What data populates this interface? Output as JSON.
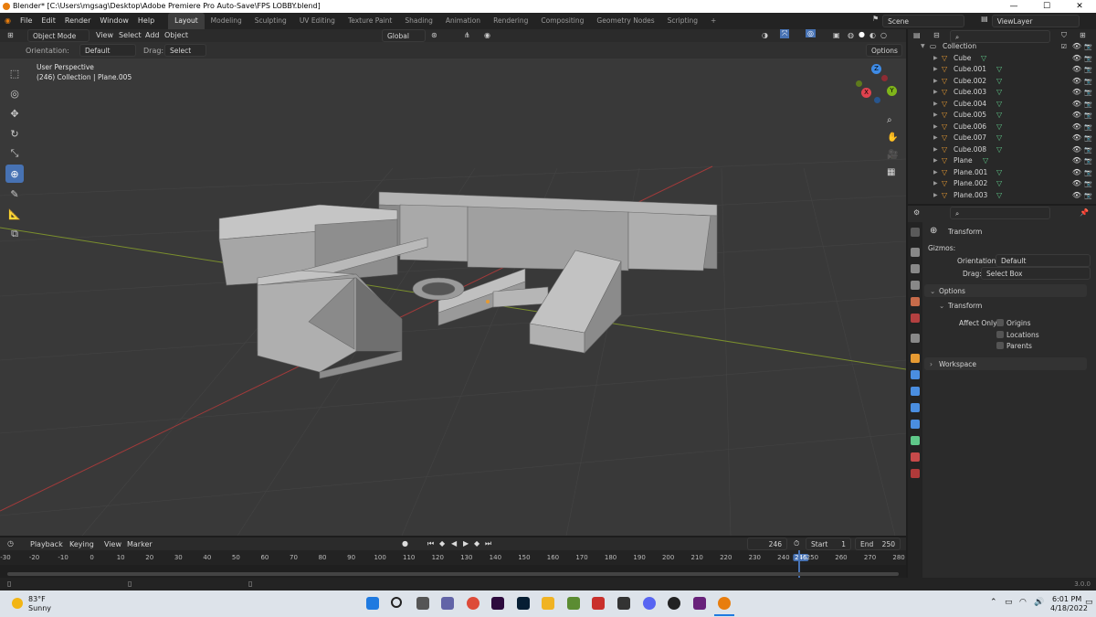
{
  "window": {
    "title": "Blender* [C:\\Users\\mgsag\\Desktop\\Adobe Premiere Pro Auto-Save\\FPS LOBBY.blend]",
    "minimize": "—",
    "maximize": "☐",
    "close": "✕"
  },
  "menu": [
    "File",
    "Edit",
    "Render",
    "Window",
    "Help"
  ],
  "workspaces": [
    "Layout",
    "Modeling",
    "Sculpting",
    "UV Editing",
    "Texture Paint",
    "Shading",
    "Animation",
    "Rendering",
    "Compositing",
    "Geometry Nodes",
    "Scripting"
  ],
  "workspace_add": "+",
  "scene": {
    "name": "Scene",
    "view_layer": "ViewLayer"
  },
  "viewport_header": {
    "mode": "Object Mode",
    "view": "View",
    "select": "Select",
    "add": "Add",
    "object": "Object",
    "transform": "Global"
  },
  "tool_header": {
    "orientation_label": "Orientation:",
    "orientation_value": "Default",
    "drag_label": "Drag:",
    "drag_value": "Select Box",
    "options": "Options"
  },
  "viewport": {
    "view_name": "User Perspective",
    "collection_info": "(246) Collection | Plane.005",
    "gizmo": {
      "x": "X",
      "y": "Y",
      "z": "Z"
    }
  },
  "outliner": {
    "root": "Collection",
    "items": [
      "Cube",
      "Cube.001",
      "Cube.002",
      "Cube.003",
      "Cube.004",
      "Cube.005",
      "Cube.006",
      "Cube.007",
      "Cube.008",
      "Plane",
      "Plane.001",
      "Plane.002",
      "Plane.003"
    ]
  },
  "properties": {
    "tool_name": "Transform",
    "gizmos_label": "Gizmos:",
    "orientation_label": "Orientation",
    "orientation_value": "Default",
    "drag_label": "Drag:",
    "drag_value": "Select Box",
    "options_panel": "Options",
    "transform_sub": "Transform",
    "affect_only": "Affect Only",
    "origins": "Origins",
    "locations": "Locations",
    "parents": "Parents",
    "workspace_panel": "Workspace"
  },
  "timeline": {
    "playback": "Playback",
    "keying": "Keying",
    "view": "View",
    "marker": "Marker",
    "current_frame": "246",
    "start_label": "Start",
    "start": "1",
    "end_label": "End",
    "end": "250",
    "ticks": [
      "-30",
      "-20",
      "-10",
      "0",
      "10",
      "20",
      "30",
      "40",
      "50",
      "60",
      "70",
      "80",
      "90",
      "100",
      "110",
      "120",
      "130",
      "140",
      "150",
      "160",
      "170",
      "180",
      "190",
      "200",
      "210",
      "220",
      "230",
      "240",
      "246",
      "250",
      "260",
      "270",
      "280"
    ]
  },
  "status": {
    "version": "3.0.0"
  },
  "taskbar": {
    "temp": "83°F",
    "weather": "Sunny",
    "time": "6:01 PM",
    "date": "4/18/2022"
  },
  "colors": {
    "accent": "#4772b3",
    "object_orange": "#e69a32",
    "mesh_green": "#5fc889",
    "axis_x": "#e0424e",
    "axis_y": "#7fb51a",
    "axis_z": "#3e8be6"
  }
}
